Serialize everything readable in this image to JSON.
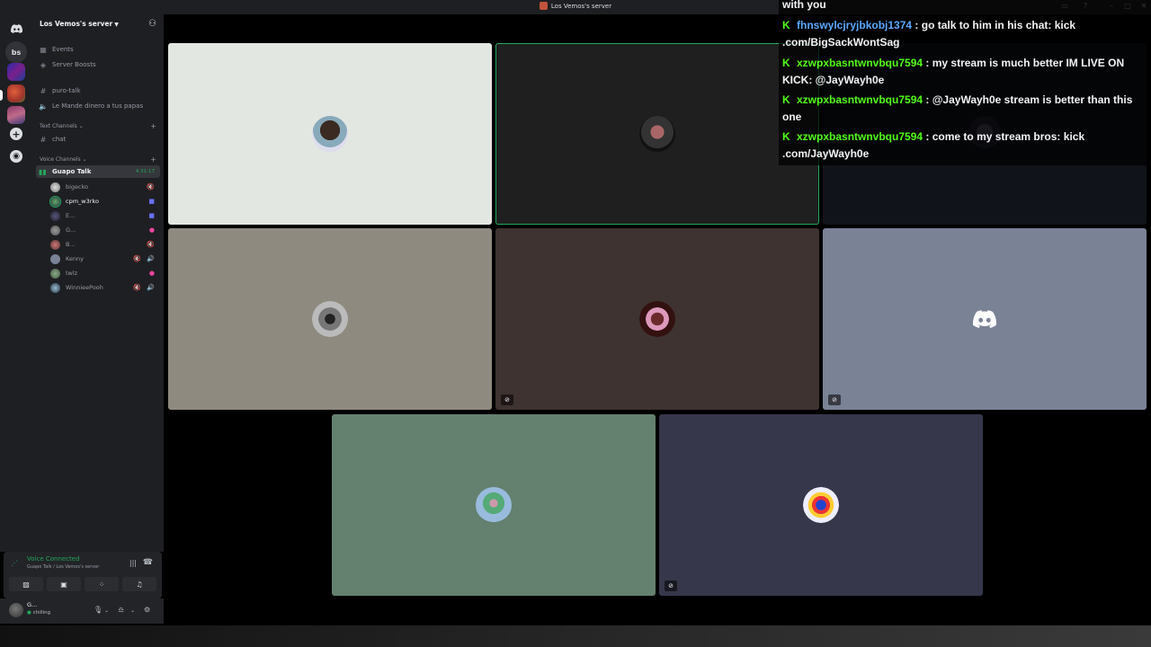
{
  "window": {
    "title": "Los Vemos's server"
  },
  "rail": {
    "dm_initials": "bs"
  },
  "server": {
    "name": "Los Vemos's server"
  },
  "sidebar": {
    "events": "Events",
    "boosts": "Server Boosts",
    "channel_puro": "puro-talk",
    "channel_mande": "Le Mande dinero a tus papas",
    "cat_text": "Text Channels",
    "channel_chat": "chat",
    "cat_voice": "Voice Channels",
    "voice_channel": "Guapo Talk",
    "voice_timer": "4:31:17"
  },
  "members": [
    {
      "name": "bigecko",
      "status": "🔇"
    },
    {
      "name": "cpm_w3rko",
      "status": "■"
    },
    {
      "name": "E...",
      "status": "■"
    },
    {
      "name": "G...",
      "status": "●"
    },
    {
      "name": "B...",
      "status": "🔇"
    },
    {
      "name": "Kenny",
      "status": "🔇 🔊"
    },
    {
      "name": "twlz",
      "status": "●"
    },
    {
      "name": "WinnieePooh",
      "status": "🔇 🔊"
    }
  ],
  "voice_panel": {
    "title": "Voice Connected",
    "subtitle": "Guapo Talk / Los Vemos's server"
  },
  "user": {
    "name": "G...",
    "status": "chilling"
  },
  "chat": {
    "header": "with you",
    "messages": [
      {
        "user": "fhnswylcjryjbkobj1374",
        "text": ": go talk to him in his chat: kick .com/BigSackWontSag"
      },
      {
        "user": "xzwpxbasntwnvbqu7594",
        "text": ": my stream is much better IM LIVE ON KICK: @JayWayh0e"
      },
      {
        "user": "xzwpxbasntwnvbqu7594",
        "text": ": @JayWayh0e stream is better than this one"
      },
      {
        "user": "xzwpxbasntwnvbqu7594",
        "text": ": come to my stream bros: kick .com/JayWayh0e"
      }
    ]
  },
  "colors": {
    "online": "#23a55a",
    "kick_green": "#53fc18",
    "tile1": "#e3e7e1",
    "tile2": "#1f1f1f",
    "tile3": "#11131a",
    "tile4": "#8f8a7f",
    "tile5": "#3e3330",
    "tile6": "#7a8296",
    "tile7": "#64806e",
    "tile8": "#36374a"
  }
}
